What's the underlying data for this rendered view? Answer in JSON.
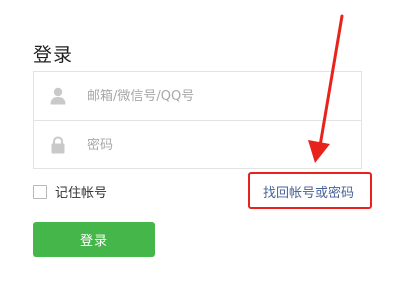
{
  "form": {
    "title": "登录",
    "account_placeholder": "邮箱/微信号/QQ号",
    "password_placeholder": "密码",
    "remember_label": "记住帐号",
    "forgot_link": "找回帐号或密码",
    "login_button": "登录"
  },
  "icons": {
    "account": "user-icon",
    "password": "lock-icon"
  },
  "colors": {
    "login_button": "#45b649",
    "link": "#49629a",
    "annotation": "#e8231b"
  }
}
